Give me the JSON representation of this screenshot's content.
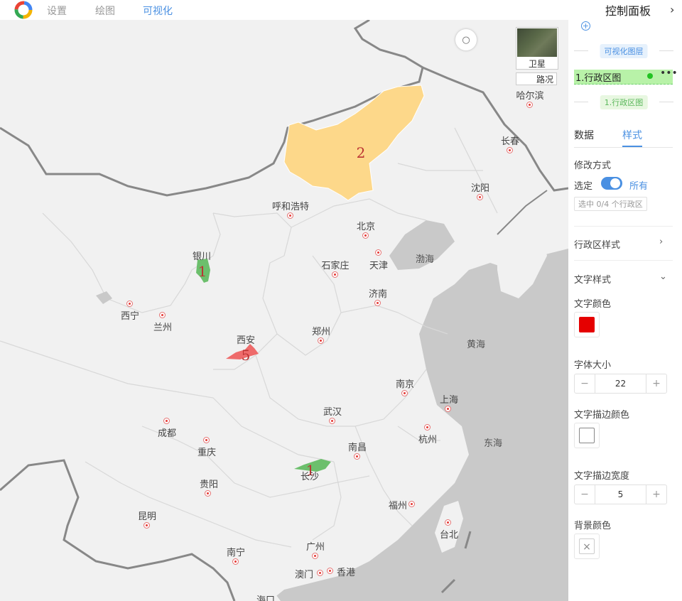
{
  "topbar": {
    "nav": [
      "设置",
      "绘图",
      "可视化"
    ]
  },
  "map": {
    "layer_switch": {
      "satellite_label": "卫星",
      "road_label": "路况"
    },
    "cities": [
      {
        "name": "哈尔滨"
      },
      {
        "name": "长春"
      },
      {
        "name": "沈阳"
      },
      {
        "name": "呼和浩特"
      },
      {
        "name": "北京"
      },
      {
        "name": "天津"
      },
      {
        "name": "石家庄"
      },
      {
        "name": "银川"
      },
      {
        "name": "济南"
      },
      {
        "name": "西宁"
      },
      {
        "name": "兰州"
      },
      {
        "name": "郑州"
      },
      {
        "name": "西安"
      },
      {
        "name": "南京"
      },
      {
        "name": "上海"
      },
      {
        "name": "武汉"
      },
      {
        "name": "成都"
      },
      {
        "name": "杭州"
      },
      {
        "name": "重庆"
      },
      {
        "name": "南昌"
      },
      {
        "name": "长沙"
      },
      {
        "name": "贵阳"
      },
      {
        "name": "福州"
      },
      {
        "name": "昆明"
      },
      {
        "name": "台北"
      },
      {
        "name": "广州"
      },
      {
        "name": "南宁"
      },
      {
        "name": "澳门"
      },
      {
        "name": "香港"
      },
      {
        "name": "海口"
      }
    ],
    "seas": [
      "渤海",
      "黄海",
      "东海"
    ],
    "regions": [
      {
        "label": "2",
        "color": "#fdd88a"
      },
      {
        "label": "1",
        "color": "#6cbf6c"
      },
      {
        "label": "5",
        "color": "#ee6b6b"
      },
      {
        "label": "1",
        "color": "#6cbf6c"
      }
    ]
  },
  "panel": {
    "title": "控制面板",
    "layers_tag": "可视化图层",
    "layer_item": "1.行政区图",
    "layer_item_tag": "1.行政区图",
    "tabs": [
      "数据",
      "样式"
    ],
    "modify_label": "修改方式",
    "select_label": "选定",
    "all_label": "所有",
    "select_hint": "选中 0/4 个行政区",
    "region_style_label": "行政区样式",
    "text_style_label": "文字样式",
    "text_color_label": "文字颜色",
    "text_color": "#e50000",
    "font_size_label": "字体大小",
    "font_size": "22",
    "stroke_color_label": "文字描边颜色",
    "stroke_width_label": "文字描边宽度",
    "stroke_width": "5",
    "bg_color_label": "背景颜色"
  }
}
